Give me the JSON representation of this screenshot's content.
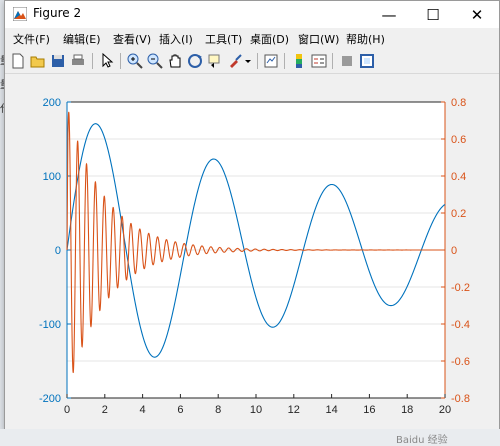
{
  "window": {
    "title": "Figure 2",
    "minimize_glyph": "—",
    "maximize_glyph": "☐",
    "close_glyph": "✕"
  },
  "menu": [
    "文件(F)",
    "编辑(E)",
    "查看(V)",
    "插入(I)",
    "工具(T)",
    "桌面(D)",
    "窗口(W)",
    "帮助(H)"
  ],
  "toolbar_icons": [
    "new-figure-icon",
    "open-file-icon",
    "save-icon",
    "print-icon",
    "pointer-icon",
    "zoom-in-icon",
    "zoom-out-icon",
    "pan-hand-icon",
    "rotate-3d-icon",
    "data-cursor-icon",
    "brush-icon",
    "dropdown-arrow-icon",
    "link-plot-icon",
    "colorbar-icon",
    "legend-icon",
    "hide-plot-tools-icon",
    "show-plot-tools-icon"
  ],
  "background": {
    "left_chars": [
      "量",
      "量",
      "代"
    ],
    "bottom_text": "Baidu 经验"
  },
  "chart_data": {
    "type": "line",
    "x_axis": {
      "ticks": [
        "0",
        "2",
        "4",
        "6",
        "8",
        "10",
        "12",
        "14",
        "16",
        "18",
        "20"
      ],
      "xlim": [
        0,
        20
      ]
    },
    "y_left": {
      "ticks": [
        "-200",
        "-100",
        "0",
        "100",
        "200"
      ],
      "ylim": [
        -200,
        200
      ],
      "color": "#0072BD"
    },
    "y_right": {
      "ticks": [
        "-0.8",
        "-0.6",
        "-0.4",
        "-0.2",
        "0",
        "0.2",
        "0.4",
        "0.6",
        "0.8"
      ],
      "ylim": [
        -0.8,
        0.8
      ],
      "color": "#D95319"
    },
    "grid": "horizontal",
    "series": [
      {
        "axis": "left",
        "color": "#0072BD",
        "x": [
          0,
          1.5,
          4.7,
          7.8,
          10.9,
          14.1,
          17.2,
          20
        ],
        "y": [
          0,
          180,
          -160,
          135,
          -115,
          98,
          -85,
          65
        ]
      },
      {
        "axis": "right",
        "color": "#D95319",
        "x": [
          0.15,
          0.38,
          0.62,
          0.85,
          1.1,
          1.35,
          2,
          3,
          4,
          5,
          6,
          7,
          8,
          10,
          14,
          20
        ],
        "y": [
          0.72,
          -0.62,
          0.53,
          -0.47,
          0.4,
          -0.34,
          0.22,
          0.12,
          0.07,
          0.04,
          0.02,
          0.01,
          0.006,
          0.002,
          0.0005,
          0
        ]
      }
    ]
  }
}
